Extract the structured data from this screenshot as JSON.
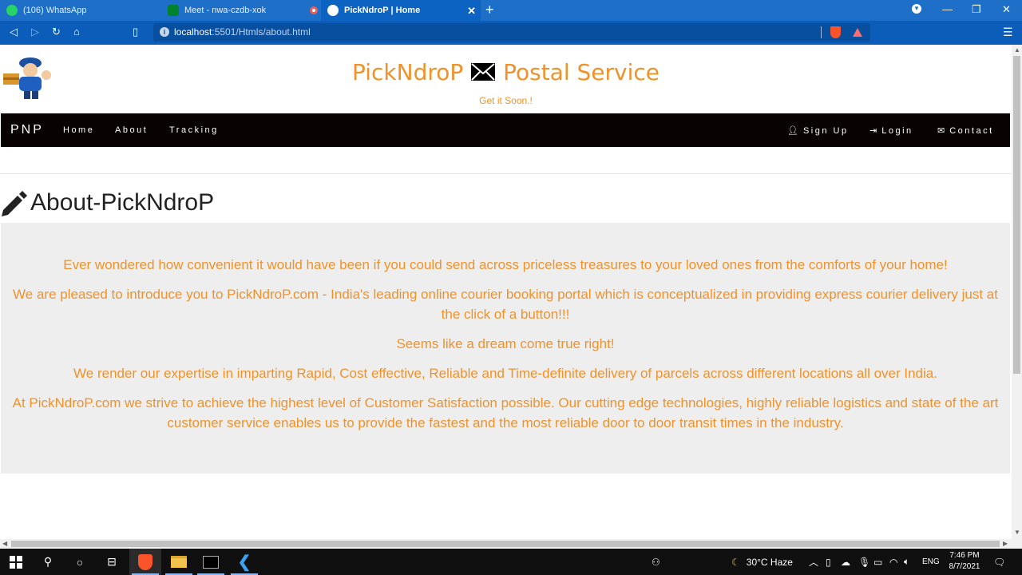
{
  "browser": {
    "tabs": [
      {
        "title": "(106) WhatsApp"
      },
      {
        "title": "Meet - nwa-czdb-xok"
      },
      {
        "title": "PickNdroP | Home"
      }
    ],
    "url_host": "localhost",
    "url_path": ":5501/Htmls/about.html"
  },
  "site": {
    "title_left": "PickNdroP",
    "title_right": "Postal Service",
    "tagline": "Get it Soon.!",
    "brand": "PNP",
    "nav_left": [
      "Home",
      "About",
      "Tracking"
    ],
    "nav_right": [
      {
        "label": "Sign Up",
        "icon": "user-icon"
      },
      {
        "label": "Login",
        "icon": "login-icon"
      },
      {
        "label": "Contact",
        "icon": "envelope-icon"
      }
    ],
    "accent_color": "#f0922a",
    "navbar_color": "#080202"
  },
  "about": {
    "heading": "About-PickNdroP",
    "paragraphs": [
      "Ever wondered how convenient it would have been if you could send across priceless treasures to your loved ones from the comforts of your home!",
      "We are pleased to introduce you to PickNdroP.com - India's leading online courier booking portal which is conceptualized in providing express courier delivery just at the click of a button!!!",
      "Seems like a dream come true right!",
      "We render our expertise in imparting Rapid, Cost effective, Reliable and Time-definite delivery of parcels across different locations all over India.",
      "At PickNdroP.com we strive to achieve the highest level of Customer Satisfaction possible. Our cutting edge technologies, highly reliable logistics and state of the art customer service enables us to provide the fastest and the most reliable door to door transit times in the industry."
    ]
  },
  "taskbar": {
    "weather_temp": "30°C",
    "weather_desc": "Haze",
    "language": "ENG",
    "time": "7:46 PM",
    "date": "8/7/2021"
  }
}
